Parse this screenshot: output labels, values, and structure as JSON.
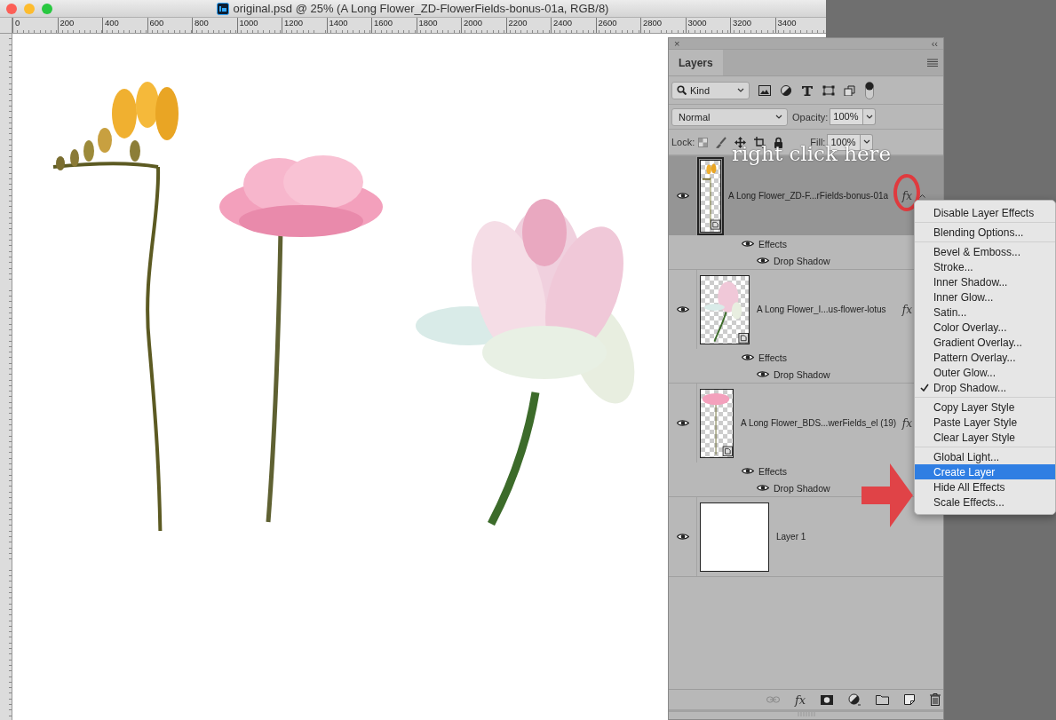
{
  "window": {
    "title": "original.psd @ 25% (A Long Flower_ZD-FlowerFields-bonus-01a, RGB/8)"
  },
  "ruler": {
    "labels": [
      "0",
      "200",
      "400",
      "600",
      "800",
      "1000",
      "1200",
      "1400",
      "1600",
      "1800",
      "2000",
      "2200",
      "2400",
      "2600",
      "2800",
      "3000",
      "3200",
      "3400"
    ]
  },
  "canvas": {
    "artwork": [
      {
        "kind": "freesia"
      },
      {
        "kind": "poppy"
      },
      {
        "kind": "lotus"
      }
    ]
  },
  "layers_panel": {
    "close_glyph": "×",
    "collapse_glyph": "‹‹",
    "tabs": [
      {
        "label": "Layers",
        "selected": true
      }
    ],
    "filter": {
      "value": "Kind"
    },
    "blend_mode": {
      "value": "Normal"
    },
    "opacity": {
      "label": "Opacity:",
      "value": "100%"
    },
    "lock": {
      "label": "Lock:"
    },
    "fill": {
      "label": "Fill:",
      "value": "100%"
    },
    "layers": [
      {
        "name": "A Long Flower_ZD-F...rFields-bonus-01a",
        "selected": true,
        "kind": "freesia",
        "fx": "fx",
        "effects_label": "Effects",
        "effects": [
          "Drop Shadow"
        ]
      },
      {
        "name": "A Long Flower_I...us-flower-lotus",
        "selected": false,
        "kind": "lotus",
        "fx": "fx",
        "effects_label": "Effects",
        "effects": [
          "Drop Shadow"
        ]
      },
      {
        "name": "A Long Flower_BDS...werFields_el (19)",
        "selected": false,
        "kind": "poppy",
        "fx": "fx",
        "effects_label": "Effects",
        "effects": [
          "Drop Shadow"
        ]
      },
      {
        "name": "Layer 1",
        "selected": false,
        "kind": "blank"
      }
    ],
    "toolbar_fx": "fx"
  },
  "context_menu": {
    "sections": [
      [
        {
          "label": "Disable Layer Effects",
          "checked": false,
          "selected": false
        }
      ],
      [
        {
          "label": "Blending Options...",
          "checked": false,
          "selected": false
        }
      ],
      [
        {
          "label": "Bevel & Emboss...",
          "checked": false,
          "selected": false
        },
        {
          "label": "Stroke...",
          "checked": false,
          "selected": false
        },
        {
          "label": "Inner Shadow...",
          "checked": false,
          "selected": false
        },
        {
          "label": "Inner Glow...",
          "checked": false,
          "selected": false
        },
        {
          "label": "Satin...",
          "checked": false,
          "selected": false
        },
        {
          "label": "Color Overlay...",
          "checked": false,
          "selected": false
        },
        {
          "label": "Gradient Overlay...",
          "checked": false,
          "selected": false
        },
        {
          "label": "Pattern Overlay...",
          "checked": false,
          "selected": false
        },
        {
          "label": "Outer Glow...",
          "checked": false,
          "selected": false
        },
        {
          "label": "Drop Shadow...",
          "checked": true,
          "selected": false
        }
      ],
      [
        {
          "label": "Copy Layer Style",
          "checked": false,
          "selected": false
        },
        {
          "label": "Paste Layer Style",
          "checked": false,
          "selected": false
        },
        {
          "label": "Clear Layer Style",
          "checked": false,
          "selected": false
        }
      ],
      [
        {
          "label": "Global Light...",
          "checked": false,
          "selected": false
        },
        {
          "label": "Create Layer",
          "checked": false,
          "selected": true
        },
        {
          "label": "Hide All Effects",
          "checked": false,
          "selected": false
        },
        {
          "label": "Scale Effects...",
          "checked": false,
          "selected": false
        }
      ]
    ]
  },
  "annotation": {
    "text": "right click here"
  }
}
